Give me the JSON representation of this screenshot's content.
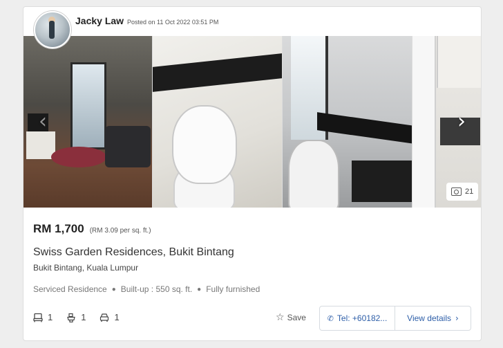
{
  "agent": {
    "name": "Jacky Law",
    "posted": "Posted on 11 Oct 2022 03:51 PM"
  },
  "gallery": {
    "photo_count": "21"
  },
  "listing": {
    "price": "RM 1,700",
    "price_psf": "(RM 3.09 per sq. ft.)",
    "title": "Swiss Garden Residences, Bukit Bintang",
    "location": "Bukit Bintang, Kuala Lumpur",
    "property_type": "Serviced Residence",
    "built_up": "Built-up : 550 sq. ft.",
    "furnishing": "Fully furnished",
    "bedrooms": "1",
    "bathrooms": "1",
    "carparks": "1"
  },
  "actions": {
    "save_label": "Save",
    "tel_label": "Tel: +60182...",
    "view_details_label": "View details"
  },
  "icons": {
    "bed": "bed-icon",
    "bath": "bath-icon",
    "car": "car-icon",
    "star": "star-outline-icon",
    "phone": "phone-icon",
    "camera": "camera-icon",
    "prev": "chevron-left-icon",
    "next": "chevron-right-icon"
  },
  "colors": {
    "link": "#2d5ea8",
    "text": "#222222",
    "muted": "#777777"
  }
}
